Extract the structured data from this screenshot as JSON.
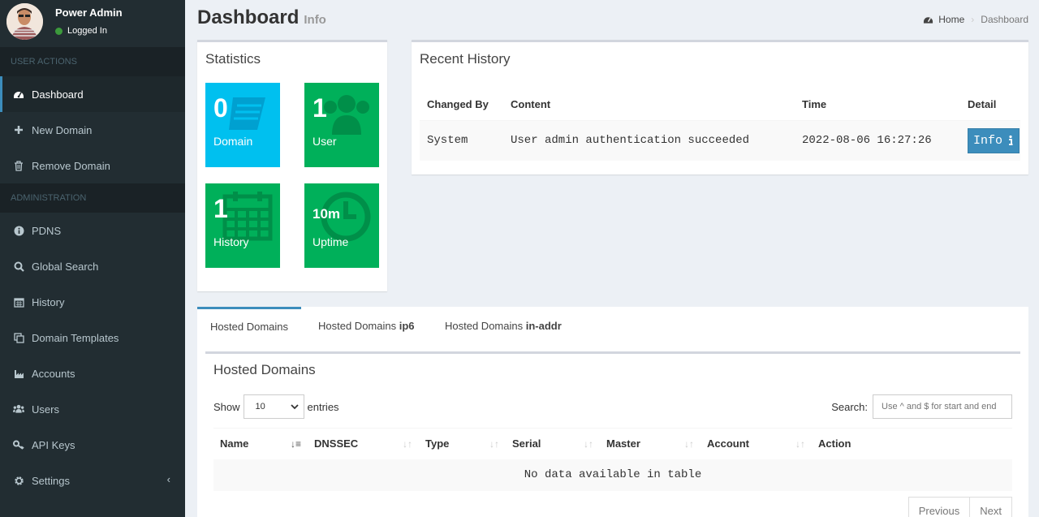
{
  "user": {
    "name": "Power Admin",
    "status": "Logged In"
  },
  "sidebar": {
    "headers": [
      "USER ACTIONS",
      "ADMINISTRATION"
    ],
    "user_actions": [
      {
        "label": "Dashboard",
        "icon": "dashboard-icon"
      },
      {
        "label": "New Domain",
        "icon": "plus-icon"
      },
      {
        "label": "Remove Domain",
        "icon": "trash-icon"
      }
    ],
    "administration": [
      {
        "label": "PDNS",
        "icon": "info-circle-icon"
      },
      {
        "label": "Global Search",
        "icon": "search-icon"
      },
      {
        "label": "History",
        "icon": "calendar-icon"
      },
      {
        "label": "Domain Templates",
        "icon": "clone-icon"
      },
      {
        "label": "Accounts",
        "icon": "industry-icon"
      },
      {
        "label": "Users",
        "icon": "users-icon"
      },
      {
        "label": "API Keys",
        "icon": "key-icon"
      },
      {
        "label": "Settings",
        "icon": "gear-icon"
      }
    ],
    "settings_caret": "‹"
  },
  "header": {
    "title": "Dashboard",
    "subtitle": "Info"
  },
  "breadcrumb": {
    "home": "Home",
    "current": "Dashboard"
  },
  "statistics": {
    "title": "Statistics",
    "tiles": [
      {
        "value": "0",
        "label": "Domain",
        "color": "#00c0ef",
        "icon": "book-icon"
      },
      {
        "value": "1",
        "label": "User",
        "color": "#00a65a",
        "icon": "users-icon"
      },
      {
        "value": "1",
        "label": "History",
        "color": "#00a65a",
        "icon": "calendar-icon"
      },
      {
        "value": "10m",
        "label": "Uptime",
        "color": "#00a65a",
        "icon": "clock-icon"
      }
    ]
  },
  "recent_history": {
    "title": "Recent History",
    "columns": [
      "Changed By",
      "Content",
      "Time",
      "Detail"
    ],
    "rows": [
      {
        "changed_by": "System",
        "content": "User admin authentication succeeded",
        "time": "2022-08-06 16:27:26",
        "detail_label": "Info"
      }
    ]
  },
  "tabs": {
    "items": [
      {
        "label": "Hosted Domains",
        "bold": ""
      },
      {
        "label": "Hosted Domains ",
        "bold": "ip6"
      },
      {
        "label": "Hosted Domains ",
        "bold": "in-addr"
      }
    ],
    "active": 0
  },
  "hosted_domains": {
    "title": "Hosted Domains",
    "show_label": "Show",
    "entries_label": "entries",
    "page_size": "10",
    "search_label": "Search:",
    "search_placeholder": "Use ^ and $ for start and end",
    "columns": [
      "Name",
      "DNSSEC",
      "Type",
      "Serial",
      "Master",
      "Account",
      "Action"
    ],
    "empty_message": "No data available in table",
    "previous": "Previous",
    "next": "Next"
  }
}
